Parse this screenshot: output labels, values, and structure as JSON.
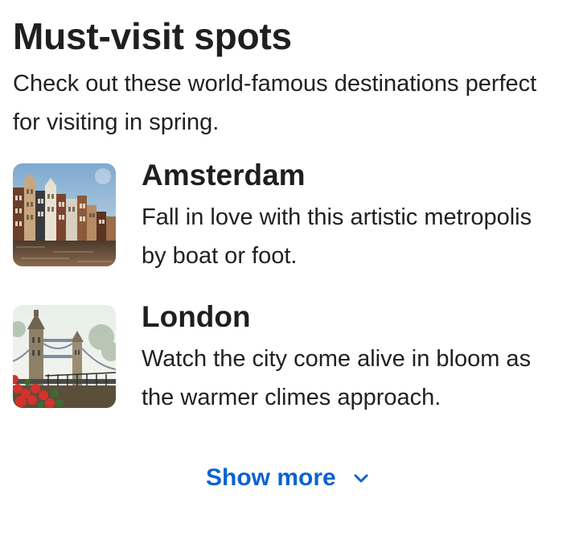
{
  "header": {
    "title": "Must-visit spots",
    "subtitle": "Check out these world-famous destinations perfect for visiting in spring."
  },
  "destinations": [
    {
      "name": "Amsterdam",
      "description": "Fall in love with this artistic metropolis by boat or foot.",
      "image_icon": "amsterdam-canal-houses-photo"
    },
    {
      "name": "London",
      "description": "Watch the city come alive in bloom as the warmer climes approach.",
      "image_icon": "tower-bridge-photo"
    }
  ],
  "footer": {
    "show_more_label": "Show more",
    "chevron_icon": "chevron-down-icon"
  },
  "colors": {
    "link": "#0b63ce",
    "text": "#1f1f1f"
  }
}
